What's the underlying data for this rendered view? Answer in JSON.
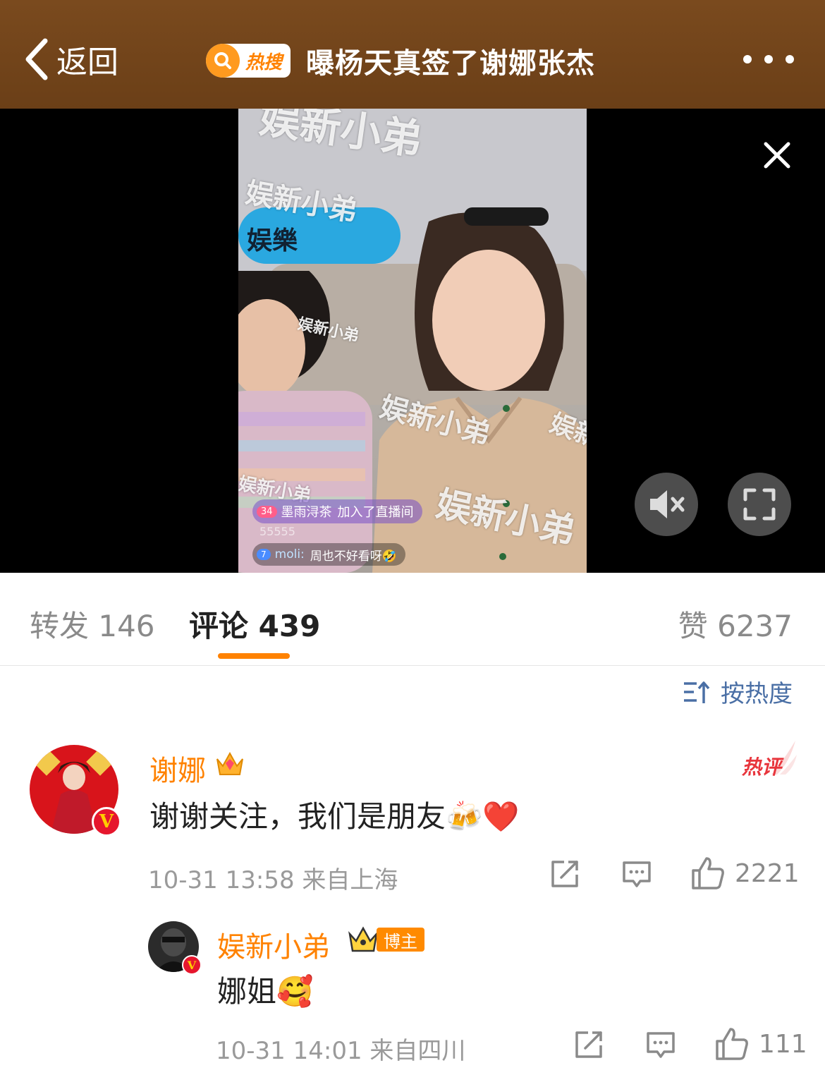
{
  "header": {
    "back_label": "返回",
    "hot_badge": "热搜",
    "title": "曝杨天真签了谢娜张杰"
  },
  "video": {
    "watermark": "娱新小弟",
    "logo_text": "娱樂",
    "live_join": {
      "level": "34",
      "user": "墨雨浔茶",
      "action": "加入了直播间"
    },
    "live_faded": "55555",
    "live_comment": {
      "level": "7",
      "user": "moli:",
      "text": "周也不好看呀🤣"
    }
  },
  "tabs": {
    "repost": "转发 146",
    "comment": "评论 439",
    "like": "赞 6237"
  },
  "sort_label": "按热度",
  "hot_tag": "热评",
  "comments": [
    {
      "name": "谢娜",
      "text": "谢谢关注，我们是朋友🍻❤️",
      "time": "10-31 13:58",
      "location": "来自上海",
      "likes": "2221"
    },
    {
      "name": "娱新小弟",
      "badge": "博主",
      "text": "娜姐🥰",
      "time": "10-31 14:01",
      "location": "来自四川",
      "likes": "111"
    }
  ],
  "colors": {
    "header_bg": "#6b3f17",
    "accent": "#ff8200",
    "link_blue": "#4a6fa5",
    "hot_red": "#e8353c",
    "verified_red": "#e6162d"
  }
}
